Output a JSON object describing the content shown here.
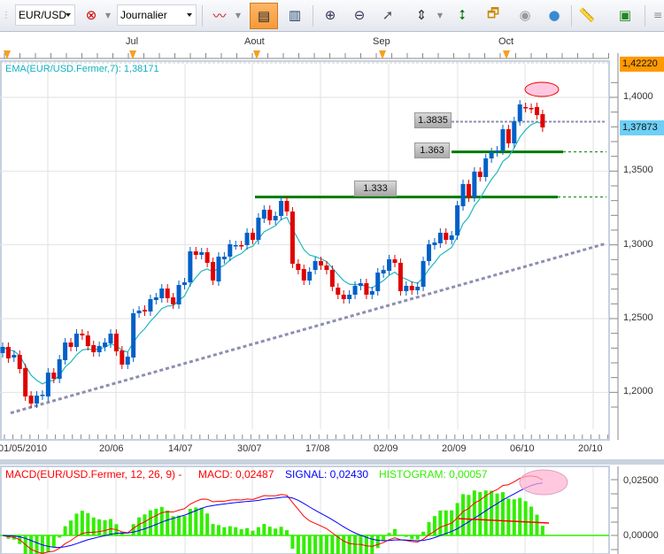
{
  "toolbar": {
    "symbol": "EUR/USD",
    "timeframe": "Journalier",
    "icons": [
      "grip-icon",
      "unlink-icon",
      "chart-type-icon",
      "chart-bars-icon",
      "chart-list-icon",
      "zoom-in-icon",
      "zoom-out-icon",
      "pointer-zoom-icon",
      "zoom-range-icon",
      "fit-vertical-icon",
      "link-page-icon",
      "eye-icon",
      "globe-icon",
      "ruler-icon",
      "image-icon"
    ]
  },
  "chart": {
    "months": [
      "Jul",
      "Aout",
      "Sep",
      "Oct"
    ],
    "dates": [
      "01/05/2010",
      "20/06",
      "14/07",
      "30/07",
      "17/08",
      "02/09",
      "20/09",
      "06/10",
      "20/10"
    ],
    "ema_label": "EMA(EUR/USD.Fermer,7): 1,38171",
    "price_axis": [
      "1,4000",
      "1,3500",
      "1,3000",
      "1,2500",
      "1,2000"
    ],
    "high_price": "1,42220",
    "current_price": "1,37873",
    "annotations": [
      "1.3835",
      "1.363",
      "1.333"
    ],
    "colors": {
      "up": "#0060c8",
      "down": "#e00000",
      "ema": "#20b8c0",
      "support": "#007a00",
      "trend": "#8c8fb0",
      "high_box": "#ff9900",
      "current_box": "#6ecff6",
      "highlight": "#ffc8e0"
    }
  },
  "macd": {
    "title": "MACD(EUR/USD.Fermer, 12, 26, 9) -",
    "macd_label": "MACD: 0,02487",
    "signal_label": "SIGNAL: 0,02430",
    "histogram_label": "HISTOGRAM: 0,00057",
    "axis": [
      "0,02500",
      "0,00000"
    ],
    "colors": {
      "macd": "#ff0000",
      "signal": "#0000ff",
      "histogram": "#33ee00"
    }
  },
  "chart_data": {
    "type": "candlestick",
    "symbol": "EUR/USD",
    "ylim": [
      1.17,
      1.4222
    ],
    "yticks": [
      1.2,
      1.25,
      1.3,
      1.35,
      1.4
    ],
    "grid": true,
    "candles_open_close": [
      [
        1.2266,
        1.2308
      ],
      [
        1.2308,
        1.223
      ],
      [
        1.2236,
        1.2254
      ],
      [
        1.2254,
        1.2158
      ],
      [
        1.2164,
        1.1972
      ],
      [
        1.1978,
        1.1924
      ],
      [
        1.1924,
        1.1978
      ],
      [
        1.1978,
        1.1984
      ],
      [
        1.1972,
        1.2134
      ],
      [
        1.2134,
        1.2092
      ],
      [
        1.2092,
        1.2224
      ],
      [
        1.2218,
        1.2338
      ],
      [
        1.2338,
        1.2308
      ],
      [
        1.2308,
        1.2398
      ],
      [
        1.2398,
        1.2386
      ],
      [
        1.2386,
        1.2314
      ],
      [
        1.232,
        1.2272
      ],
      [
        1.2272,
        1.2314
      ],
      [
        1.2308,
        1.2338
      ],
      [
        1.2332,
        1.2398
      ],
      [
        1.2398,
        1.2278
      ],
      [
        1.2284,
        1.2188
      ],
      [
        1.2188,
        1.2242
      ],
      [
        1.2236,
        1.2536
      ],
      [
        1.2536,
        1.2554
      ],
      [
        1.256,
        1.2548
      ],
      [
        1.2548,
        1.2632
      ],
      [
        1.2626,
        1.2644
      ],
      [
        1.2638,
        1.2704
      ],
      [
        1.2704,
        1.2638
      ],
      [
        1.2644,
        1.2596
      ],
      [
        1.2596,
        1.2728
      ],
      [
        1.2728,
        1.2746
      ],
      [
        1.2746,
        1.2956
      ],
      [
        1.2956,
        1.2932
      ],
      [
        1.2932,
        1.295
      ],
      [
        1.295,
        1.2878
      ],
      [
        1.2884,
        1.2758
      ],
      [
        1.2752,
        1.292
      ],
      [
        1.2902,
        1.292
      ],
      [
        1.292,
        1.3004
      ],
      [
        1.2998,
        1.2998
      ],
      [
        1.2998,
        1.2996
      ],
      [
        1.2998,
        1.3082
      ],
      [
        1.3082,
        1.3034
      ],
      [
        1.3034,
        1.3184
      ],
      [
        1.3178,
        1.3238
      ],
      [
        1.3238,
        1.3166
      ],
      [
        1.3166,
        1.3196
      ],
      [
        1.3196,
        1.3298
      ],
      [
        1.3298,
        1.3226
      ],
      [
        1.3226,
        1.2872
      ],
      [
        1.2872,
        1.283
      ],
      [
        1.2836,
        1.2758
      ],
      [
        1.2758,
        1.2818
      ],
      [
        1.283,
        1.289
      ],
      [
        1.289,
        1.286
      ],
      [
        1.286,
        1.283
      ],
      [
        1.283,
        1.2716
      ],
      [
        1.271,
        1.2662
      ],
      [
        1.2662,
        1.2632
      ],
      [
        1.2632,
        1.2662
      ],
      [
        1.2662,
        1.2722
      ],
      [
        1.2722,
        1.274
      ],
      [
        1.274,
        1.2662
      ],
      [
        1.2662,
        1.2686
      ],
      [
        1.2686,
        1.2812
      ],
      [
        1.2806,
        1.283
      ],
      [
        1.2824,
        1.2902
      ],
      [
        1.2902,
        1.2878
      ],
      [
        1.2878,
        1.2686
      ],
      [
        1.2686,
        1.2722
      ],
      [
        1.2722,
        1.2692
      ],
      [
        1.2692,
        1.2716
      ],
      [
        1.2716,
        1.289
      ],
      [
        1.289,
        1.3004
      ],
      [
        1.2998,
        1.3016
      ],
      [
        1.301,
        1.3082
      ],
      [
        1.3082,
        1.3034
      ],
      [
        1.3034,
        1.3064
      ],
      [
        1.3064,
        1.3268
      ],
      [
        1.3262,
        1.3412
      ],
      [
        1.3412,
        1.3322
      ],
      [
        1.3322,
        1.3496
      ],
      [
        1.3496,
        1.346
      ],
      [
        1.346,
        1.3586
      ],
      [
        1.3586,
        1.3628
      ],
      [
        1.3628,
        1.364
      ],
      [
        1.364,
        1.3784
      ],
      [
        1.3784,
        1.3688
      ],
      [
        1.3688,
        1.3838
      ],
      [
        1.3838,
        1.3952
      ],
      [
        1.3934,
        1.3928
      ],
      [
        1.3928,
        1.3922
      ],
      [
        1.3934,
        1.388
      ],
      [
        1.3886,
        1.3796
      ]
    ],
    "horizontal_lines": [
      1.3835,
      1.363,
      1.333
    ],
    "trendline": [
      1.186,
      1.301
    ],
    "ema_period": 7,
    "macd_params": [
      12,
      26,
      9
    ],
    "macd_ylim": [
      -0.005,
      0.03
    ]
  }
}
